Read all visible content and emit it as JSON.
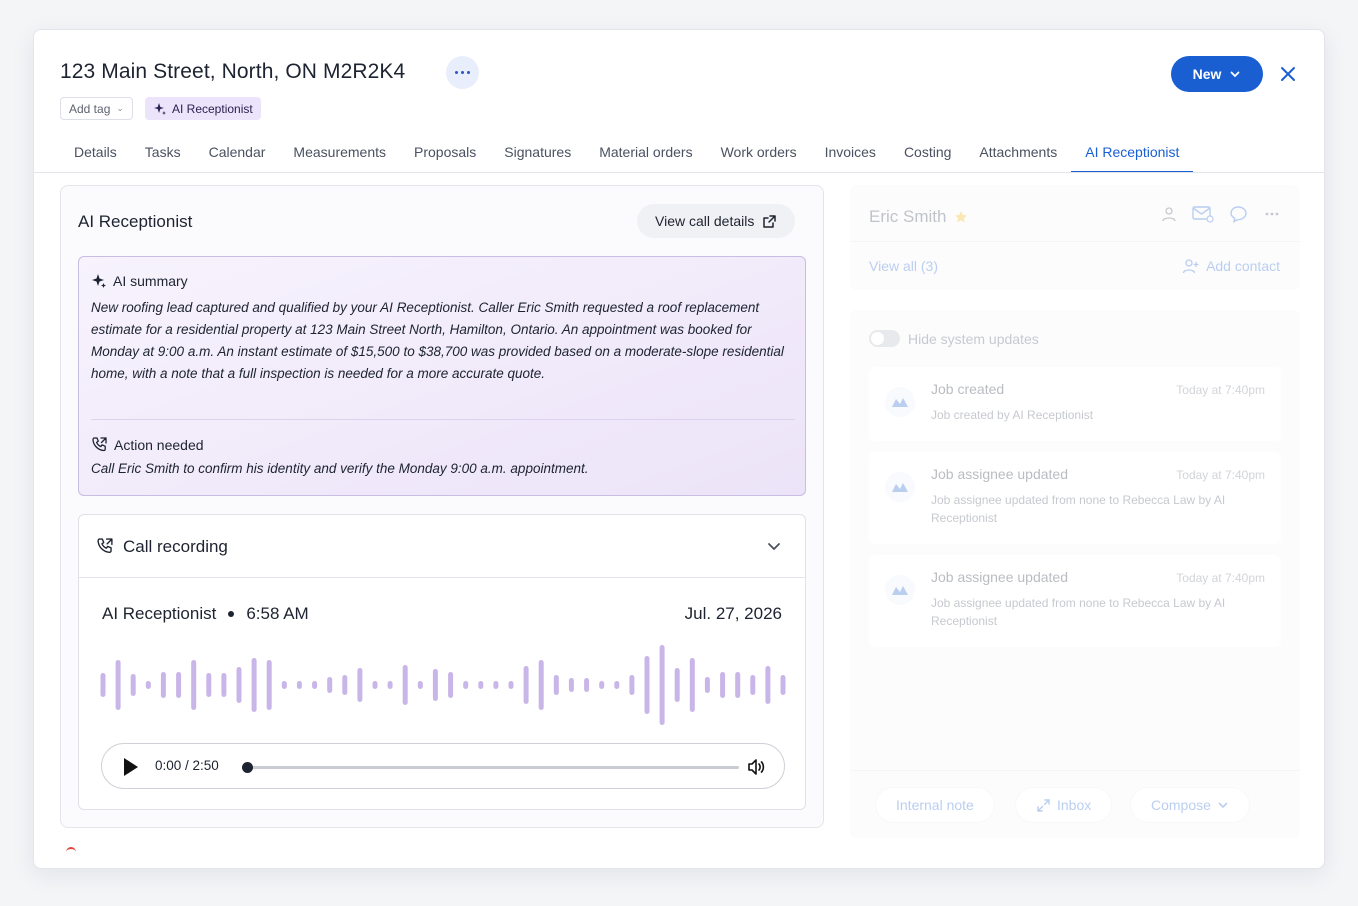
{
  "header": {
    "title": "123 Main Street, North, ON M2R2K4",
    "add_tag": "Add tag",
    "ai_tag": "AI Receptionist",
    "new_label": "New"
  },
  "tabs": [
    {
      "label": "Details"
    },
    {
      "label": "Tasks"
    },
    {
      "label": "Calendar"
    },
    {
      "label": "Measurements"
    },
    {
      "label": "Proposals"
    },
    {
      "label": "Signatures"
    },
    {
      "label": "Material orders"
    },
    {
      "label": "Work orders"
    },
    {
      "label": "Invoices"
    },
    {
      "label": "Costing"
    },
    {
      "label": "Attachments"
    },
    {
      "label": "AI Receptionist",
      "active": true
    }
  ],
  "ai_panel": {
    "title": "AI Receptionist",
    "view_details": "View call details",
    "summary_label": "AI summary",
    "summary_text": "New roofing lead captured and qualified by your AI Receptionist.  Caller Eric Smith requested a roof replacement estimate for a residential property at 123 Main Street North, Hamilton, Ontario. An appointment was booked for Monday at 9:00 a.m. An instant estimate of $15,500 to $38,700 was provided based on a moderate-slope residential home, with a note that a full inspection is needed for a more accurate quote.",
    "action_label": "Action needed",
    "action_text": "Call Eric Smith to confirm his identity and verify the Monday 9:00 a.m. appointment."
  },
  "recording": {
    "title": "Call recording",
    "caller": "AI Receptionist",
    "time": "6:58 AM",
    "date": "Jul. 27, 2026",
    "playback": "0:00 / 2:50",
    "progress": 0
  },
  "contact": {
    "name": "Eric Smith",
    "view_all": "View all (3)",
    "add_contact": "Add contact"
  },
  "feed": {
    "toggle_label": "Hide system updates",
    "entries": [
      {
        "title": "Job created",
        "time": "Today at 7:40pm",
        "body": "Job created by AI Receptionist"
      },
      {
        "title": "Job assignee updated",
        "time": "Today at 7:40pm",
        "body": "Job assignee updated from none to Rebecca Law by AI Receptionist"
      },
      {
        "title": "Job assignee updated",
        "time": "Today at 7:40pm",
        "body": "Job assignee updated from none to Rebecca Law by AI Receptionist"
      }
    ]
  },
  "compose": {
    "internal_note": "Internal note",
    "inbox": "Inbox",
    "compose": "Compose"
  },
  "colors": {
    "accent": "#1a5fd1",
    "ai_tag_bg": "#ece4fa",
    "summary_border": "#c8bde3",
    "waveform": "#c9b6e8"
  }
}
